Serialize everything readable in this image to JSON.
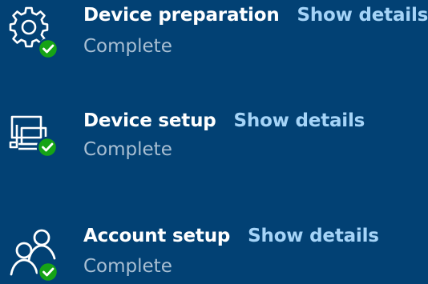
{
  "steps": [
    {
      "title": "Device preparation",
      "link": "Show details",
      "status": "Complete",
      "icon": "gear-icon"
    },
    {
      "title": "Device setup",
      "link": "Show details",
      "status": "Complete",
      "icon": "devices-icon"
    },
    {
      "title": "Account setup",
      "link": "Show details",
      "status": "Complete",
      "icon": "people-icon"
    }
  ],
  "colors": {
    "background": "#024174",
    "title": "#ffffff",
    "link": "#a5d4f8",
    "status": "#a9bfd3",
    "check": "#16a316"
  }
}
